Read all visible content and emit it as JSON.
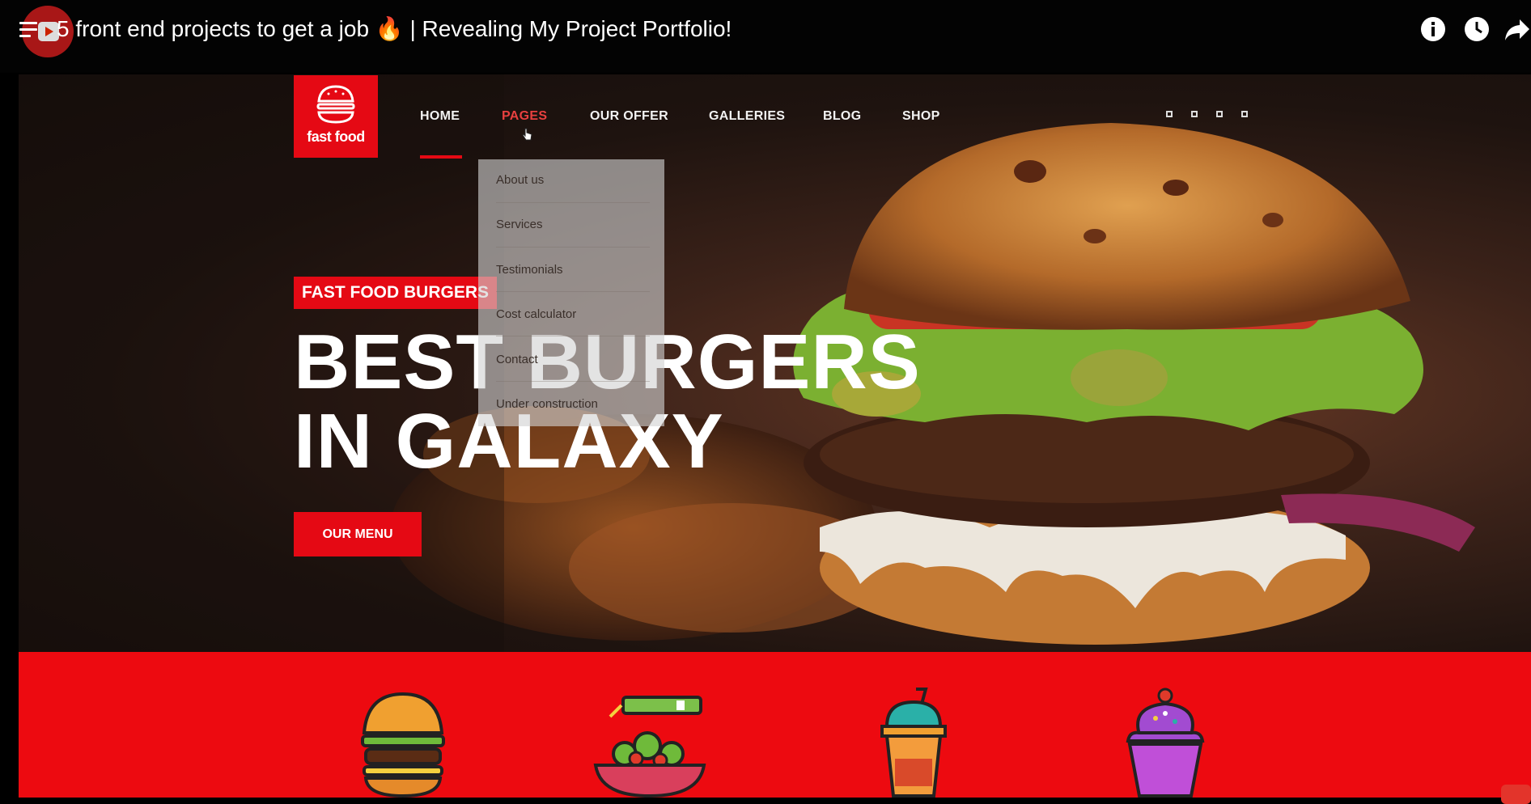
{
  "video": {
    "title": "5 front end projects to get a job 🔥 | Revealing My Project Portfolio!",
    "icons": [
      "playlist-icon",
      "youtube-logo-icon",
      "info-icon",
      "watch-later-icon",
      "share-icon"
    ]
  },
  "site": {
    "brand": {
      "name": "fast food",
      "icon": "burger-logo-icon",
      "color": "#e50914"
    },
    "nav": [
      {
        "label": "HOME",
        "active": true
      },
      {
        "label": "PAGES",
        "hovered": true
      },
      {
        "label": "OUR OFFER"
      },
      {
        "label": "GALLERIES"
      },
      {
        "label": "BLOG"
      },
      {
        "label": "SHOP"
      }
    ],
    "dropdown": [
      "About us",
      "Services",
      "Testimonials",
      "Cost calculator",
      "Contact",
      "Under construction"
    ],
    "hero": {
      "tag": "FAST FOOD BURGERS",
      "headline_line1": "BEST BURGERS",
      "headline_line2": "IN GALAXY",
      "cta": "OUR MENU"
    },
    "categories": [
      "burger-icon",
      "salad-icon",
      "drink-icon",
      "cupcake-icon"
    ]
  },
  "colors": {
    "accent": "#e50914",
    "band": "#ed0a10",
    "topbar": "#030303"
  }
}
